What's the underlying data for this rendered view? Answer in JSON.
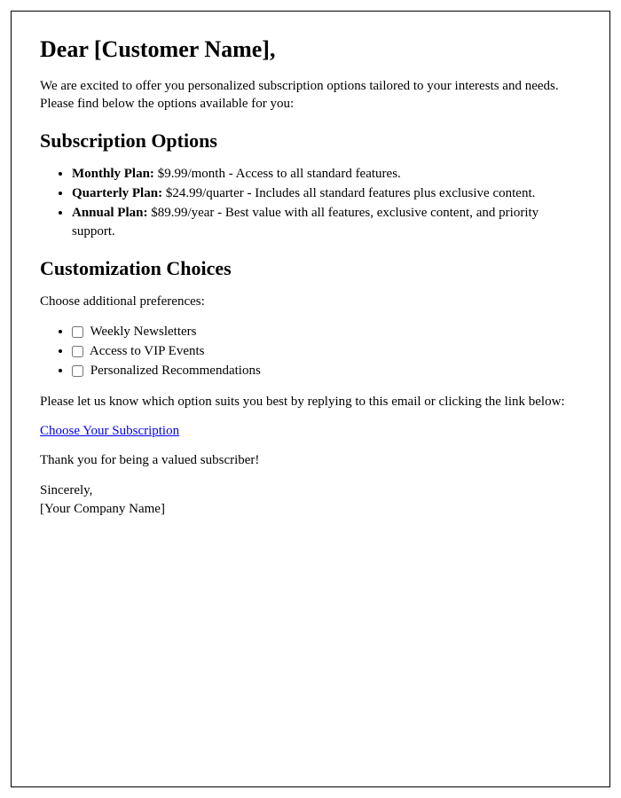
{
  "greeting": "Dear [Customer Name],",
  "intro": "We are excited to offer you personalized subscription options tailored to your interests and needs. Please find below the options available for you:",
  "subscription_heading": "Subscription Options",
  "plans": [
    {
      "label": "Monthly Plan:",
      "desc": " $9.99/month - Access to all standard features."
    },
    {
      "label": "Quarterly Plan:",
      "desc": " $24.99/quarter - Includes all standard features plus exclusive content."
    },
    {
      "label": "Annual Plan:",
      "desc": " $89.99/year - Best value with all features, exclusive content, and priority support."
    }
  ],
  "customization_heading": "Customization Choices",
  "customization_intro": "Choose additional preferences:",
  "choices": [
    " Weekly Newsletters",
    " Access to VIP Events",
    " Personalized Recommendations"
  ],
  "cta_text": "Please let us know which option suits you best by replying to this email or clicking the link below:",
  "link_text": "Choose Your Subscription",
  "thank_you": "Thank you for being a valued subscriber!",
  "signoff_line1": "Sincerely,",
  "signoff_line2": "[Your Company Name]"
}
